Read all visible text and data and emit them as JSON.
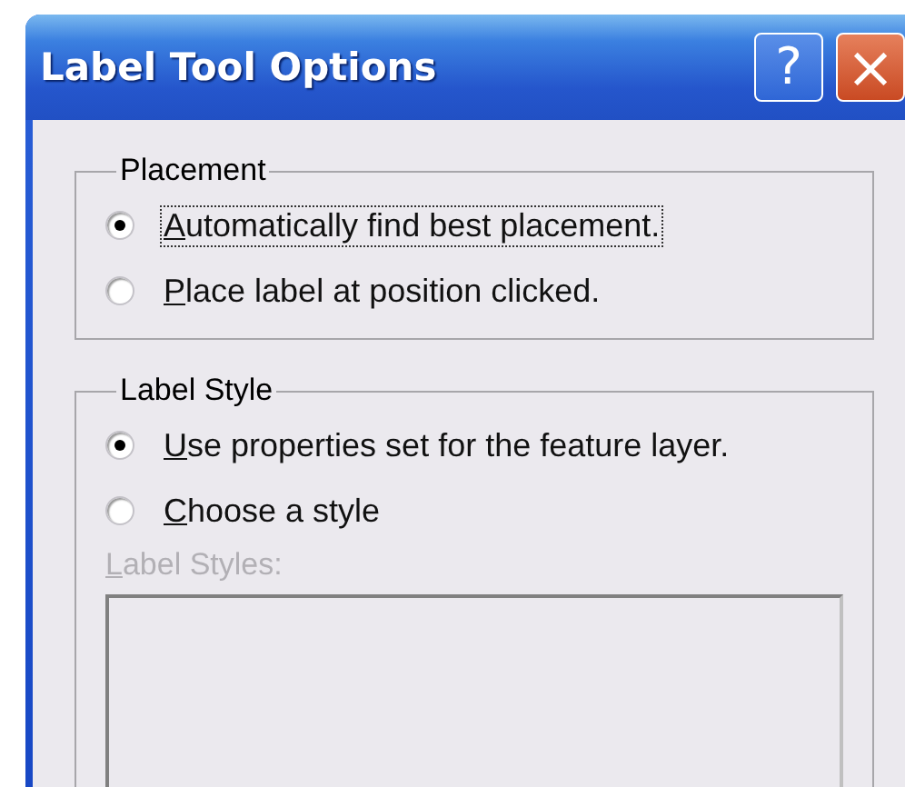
{
  "window": {
    "title": "Label Tool Options"
  },
  "title_buttons": [
    {
      "kind": "help",
      "label": "?"
    },
    {
      "kind": "close",
      "label": "×"
    }
  ],
  "groups": [
    {
      "title": "Placement",
      "options": [
        {
          "label": "Automatically find best placement.",
          "selected": true,
          "focused": true
        },
        {
          "label": "Place label at position clicked.",
          "selected": false,
          "focused": false
        }
      ]
    },
    {
      "title": "Label Style",
      "options": [
        {
          "label": "Use properties set for the feature layer.",
          "selected": true,
          "focused": false
        },
        {
          "label": "Choose a style",
          "selected": false,
          "focused": false
        }
      ],
      "list": {
        "label": "Label Styles:",
        "disabled": true
      }
    }
  ]
}
